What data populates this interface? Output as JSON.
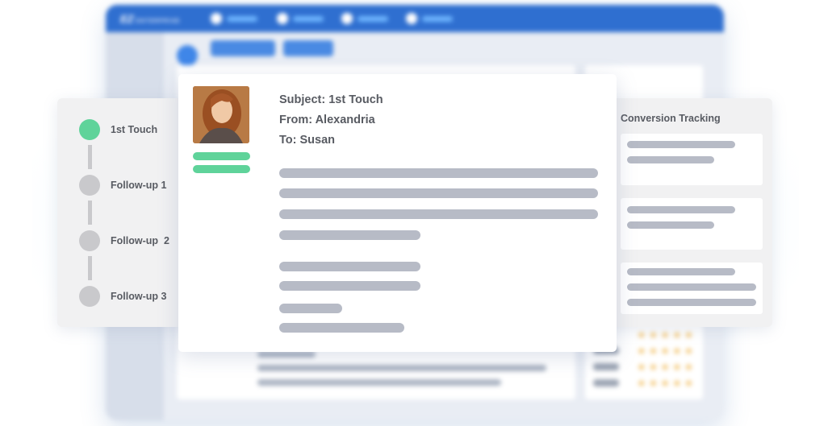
{
  "background_app": {
    "logo": "EZ",
    "logo_sub": "ENTERPRISE"
  },
  "sequence": {
    "steps": [
      {
        "label": "1st Touch",
        "active": true
      },
      {
        "label": "Follow-up 1",
        "active": false
      },
      {
        "label": "Follow-up  2",
        "active": false
      },
      {
        "label": "Follow-up 3",
        "active": false
      }
    ]
  },
  "email": {
    "subject": "Subject: 1st Touch",
    "from": "From: Alexandria",
    "to": "To: Susan"
  },
  "conversion": {
    "title": "Conversion Tracking"
  },
  "colors": {
    "accent_green": "#5fd39a",
    "brand_blue": "#2f6fd0",
    "placeholder_gray": "#b7bbc6"
  }
}
